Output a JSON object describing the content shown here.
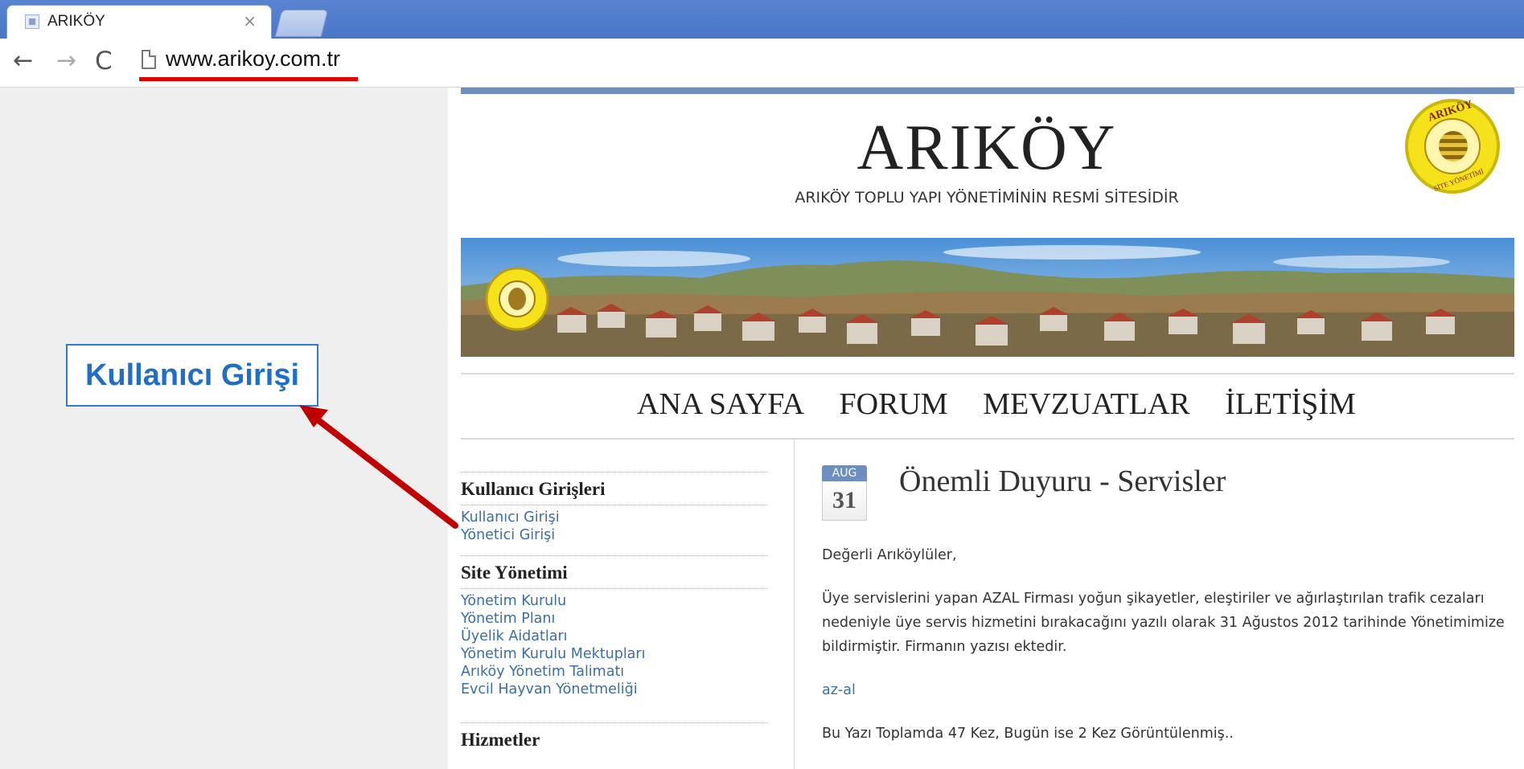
{
  "browser": {
    "tab_title": "ARIKÖY",
    "tab_close": "×",
    "url": "www.arikoy.com.tr",
    "back_icon": "←",
    "forward_icon": "→",
    "reload_icon": "C"
  },
  "site": {
    "title": "ARIKÖY",
    "subtitle": "ARIKÖY TOPLU YAPI YÖNETİMİNİN RESMİ SİTESİDİR",
    "logo_text_top": "ARIKÖY",
    "logo_text_bottom": "SİTE YÖNETİMİ"
  },
  "nav": {
    "home": "ANA SAYFA",
    "forum": "FORUM",
    "laws": "MEVZUATLAR",
    "contact": "İLETİŞİM"
  },
  "sidebar": {
    "user_logins": {
      "heading": "Kullanıcı Girişleri",
      "items": [
        "Kullanıcı Girişi",
        "Yönetici Girişi"
      ]
    },
    "site_management": {
      "heading": "Site Yönetimi",
      "items": [
        "Yönetim Kurulu",
        "Yönetim Planı",
        "Üyelik Aidatları",
        "Yönetim Kurulu Mektupları",
        "Arıköy Yönetim Talimatı",
        "Evcil Hayvan Yönetmeliği"
      ]
    },
    "services": {
      "heading": "Hizmetler"
    }
  },
  "post": {
    "month": "AUG",
    "day": "31",
    "title": "Önemli Duyuru - Servisler",
    "greeting": "Değerli Arıköylüler,",
    "body": "Üye servislerini yapan AZAL Firması yoğun şikayetler, eleştiriler ve ağırlaştırılan trafik cezaları nedeniyle üye servis hizmetini bırakacağını yazılı olarak 31 Ağustos 2012 tarihinde Yönetimimize bildirmiştir. Firmanın yazısı ektedir.",
    "attachment_link": "az-al",
    "view_count": "Bu Yazı Toplamda 47 Kez, Bugün ise 2 Kez Görüntülenmiş.."
  },
  "annotation": {
    "callout": "Kullanıcı Girişi",
    "arrow_color": "#c00000",
    "callout_border": "#2e7bd1"
  }
}
